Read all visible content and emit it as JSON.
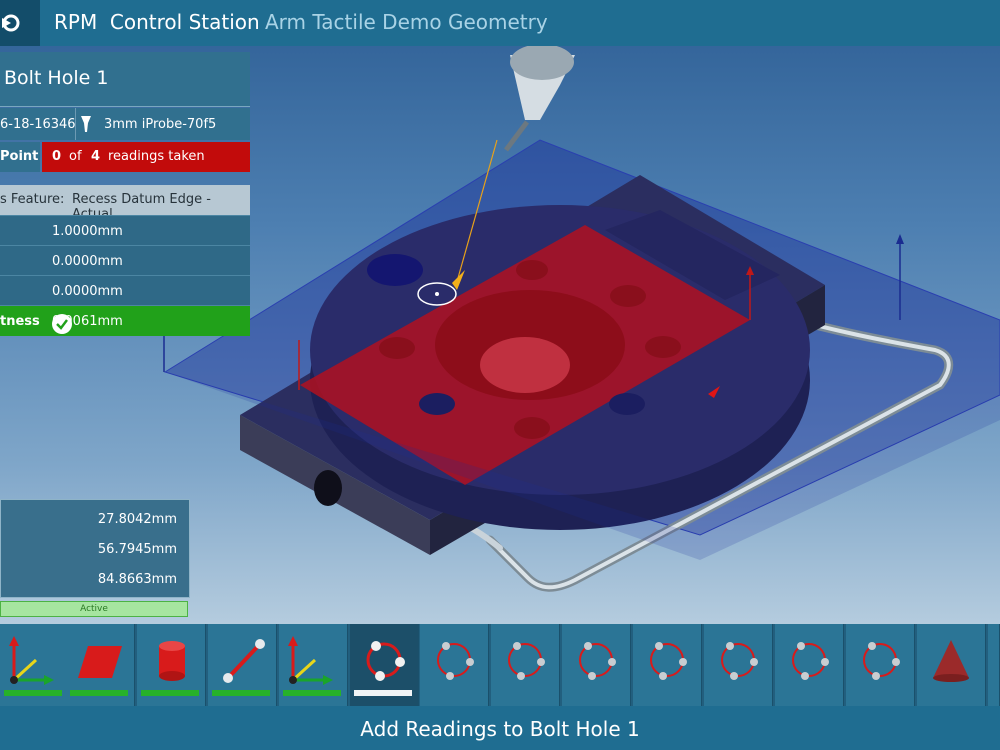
{
  "header": {
    "app_title": "RPM  Control Station",
    "document_title": "Arm Tactile Demo Geometry"
  },
  "feature_panel": {
    "title": "Bolt Hole 1",
    "serial": "6-18-16346",
    "probe": "3mm iProbe-70f5",
    "point_label": "Point",
    "readings_taken": "0",
    "readings_of": "of",
    "readings_total": "4",
    "readings_suffix": "readings taken",
    "datum_label": "s Feature:",
    "datum_value": "Recess Datum Edge - Actual",
    "values": [
      "1.0000mm",
      "0.0000mm",
      "0.0000mm"
    ],
    "flatness_label": "tness",
    "flatness_value": "0.0061mm"
  },
  "dimensions": {
    "values": [
      "27.8042mm",
      "56.7945mm",
      "84.8663mm"
    ],
    "status": "Active"
  },
  "toolbar": {
    "tools": [
      {
        "name": "plane-axis-tool",
        "state": "done"
      },
      {
        "name": "plane-tool",
        "state": "done"
      },
      {
        "name": "cylinder-tool",
        "state": "done"
      },
      {
        "name": "line-tool",
        "state": "done"
      },
      {
        "name": "axis-tool",
        "state": "done"
      },
      {
        "name": "circle-tool",
        "state": "active"
      },
      {
        "name": "circle-tool",
        "state": "pending"
      },
      {
        "name": "circle-tool",
        "state": "pending"
      },
      {
        "name": "circle-tool",
        "state": "pending"
      },
      {
        "name": "circle-tool",
        "state": "pending"
      },
      {
        "name": "circle-tool",
        "state": "pending"
      },
      {
        "name": "circle-tool",
        "state": "pending"
      },
      {
        "name": "circle-tool",
        "state": "pending"
      },
      {
        "name": "cone-tool",
        "state": "pending"
      }
    ]
  },
  "status_bar": {
    "message": "Add Readings to Bolt Hole 1"
  },
  "colors": {
    "accent": "#1f6d91",
    "alert_red": "#c20b0b",
    "ok_green": "#21a11a",
    "part_red": "#b01020"
  }
}
